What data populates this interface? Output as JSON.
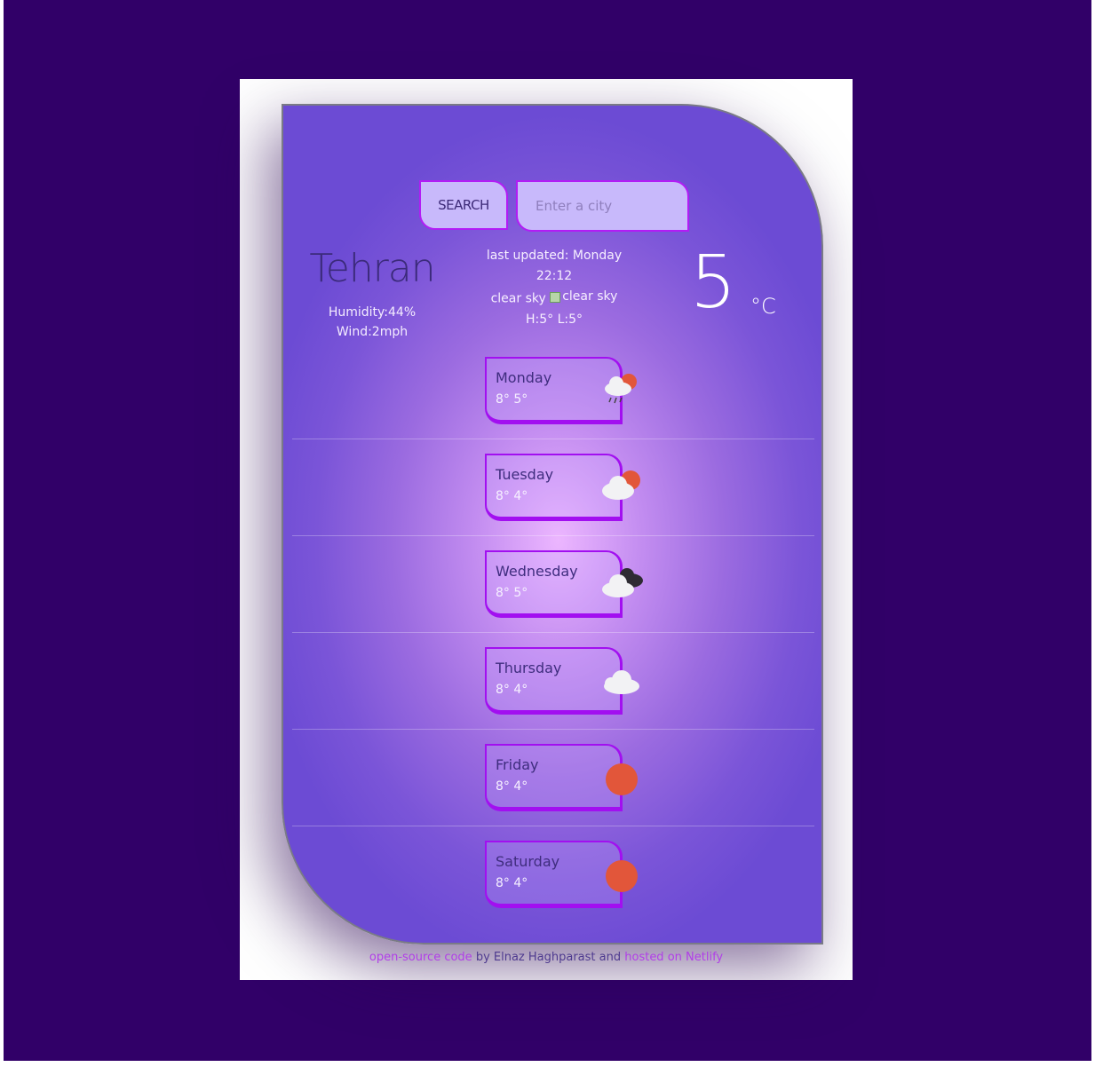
{
  "search": {
    "button_label": "SEARCH",
    "placeholder": "Enter a city"
  },
  "current": {
    "city": "Tehran",
    "humidity": "Humidity:44%",
    "wind": "Wind:2mph",
    "updated_label": "last updated: Monday",
    "updated_time": "22:12",
    "description": "clear sky",
    "icon_alt": "clear sky",
    "high_low": "H:5° L:5°",
    "temperature": "5",
    "unit": "°C"
  },
  "forecast": [
    {
      "day": "Monday",
      "temps": "8° 5°",
      "icon": "rain-cloud-sun-icon"
    },
    {
      "day": "Tuesday",
      "temps": "8° 4°",
      "icon": "cloud-sun-icon"
    },
    {
      "day": "Wednesday",
      "temps": "8° 5°",
      "icon": "dark-clouds-icon"
    },
    {
      "day": "Thursday",
      "temps": "8° 4°",
      "icon": "cloud-icon"
    },
    {
      "day": "Friday",
      "temps": "8° 4°",
      "icon": "sun-icon"
    },
    {
      "day": "Saturday",
      "temps": "8° 4°",
      "icon": "sun-icon"
    }
  ],
  "footer": {
    "link1": "open-source code",
    "text1": " by Elnaz Haghparast and ",
    "link2": "hosted on Netlify"
  },
  "colors": {
    "background": "#310068",
    "accent": "#a20ff0",
    "sun": "#e2563a"
  }
}
